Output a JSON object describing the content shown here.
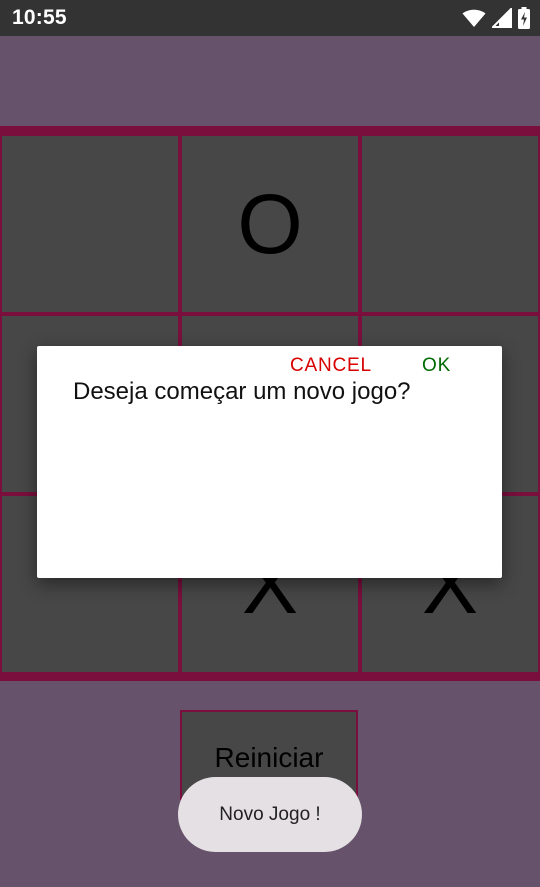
{
  "status_bar": {
    "time": "10:55",
    "icons": [
      "wifi-icon",
      "cellular-signal-icon",
      "battery-charging-icon"
    ]
  },
  "board": {
    "cells": [
      "",
      "O",
      "",
      "",
      "",
      "",
      "",
      "X",
      "X"
    ]
  },
  "restart_button": {
    "label": "Reiniciar"
  },
  "dialog": {
    "title": "Deseja começar um novo jogo?",
    "cancel_label": "CANCEL",
    "ok_label": "OK"
  },
  "toast": {
    "text": "Novo Jogo !"
  },
  "colors": {
    "background": "#66526a",
    "board_lines": "#7a0f3d",
    "cell": "#474747",
    "cancel": "#d80000",
    "ok": "#006b00"
  }
}
